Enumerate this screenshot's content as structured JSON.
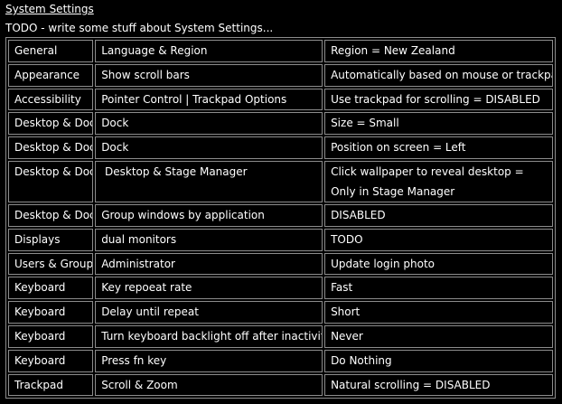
{
  "header": {
    "title": "System Settings",
    "intro": "TODO - write some stuff about System Settings..."
  },
  "settings": [
    {
      "category": "General",
      "setting": "Language & Region",
      "value": [
        "Region = New Zealand"
      ]
    },
    {
      "category": "Appearance",
      "setting": "Show scroll bars",
      "value": [
        "Automatically based on mouse or trackpad"
      ]
    },
    {
      "category": "Accessibility",
      "setting": "Pointer Control | Trackpad Options",
      "value": [
        "Use trackpad for scrolling = DISABLED"
      ]
    },
    {
      "category": "Desktop & Dock",
      "setting": "Dock",
      "value": [
        "Size = Small"
      ]
    },
    {
      "category": "Desktop & Dock",
      "setting": "Dock",
      "value": [
        "Position on screen = Left"
      ]
    },
    {
      "category": "Desktop & Dock",
      "setting": " Desktop & Stage Manager",
      "value": [
        "Click wallpaper to reveal desktop =",
        "Only in Stage Manager"
      ]
    },
    {
      "category": "Desktop & Dock",
      "setting": "Group windows by application",
      "value": [
        "DISABLED"
      ]
    },
    {
      "category": "Displays",
      "setting": "dual monitors",
      "value": [
        "TODO"
      ]
    },
    {
      "category": "Users & Groups",
      "setting": "Administrator",
      "value": [
        "Update login photo"
      ]
    },
    {
      "category": "Keyboard",
      "setting": "Key repoeat rate",
      "value": [
        "Fast"
      ]
    },
    {
      "category": "Keyboard",
      "setting": "Delay until repeat",
      "value": [
        "Short"
      ]
    },
    {
      "category": "Keyboard",
      "setting": "Turn keyboard backlight off after inactivity",
      "value": [
        "Never"
      ]
    },
    {
      "category": "Keyboard",
      "setting": "Press fn key",
      "value": [
        "Do Nothing"
      ]
    },
    {
      "category": "Trackpad",
      "setting": "Scroll & Zoom",
      "value": [
        "Natural scrolling = DISABLED"
      ]
    }
  ]
}
